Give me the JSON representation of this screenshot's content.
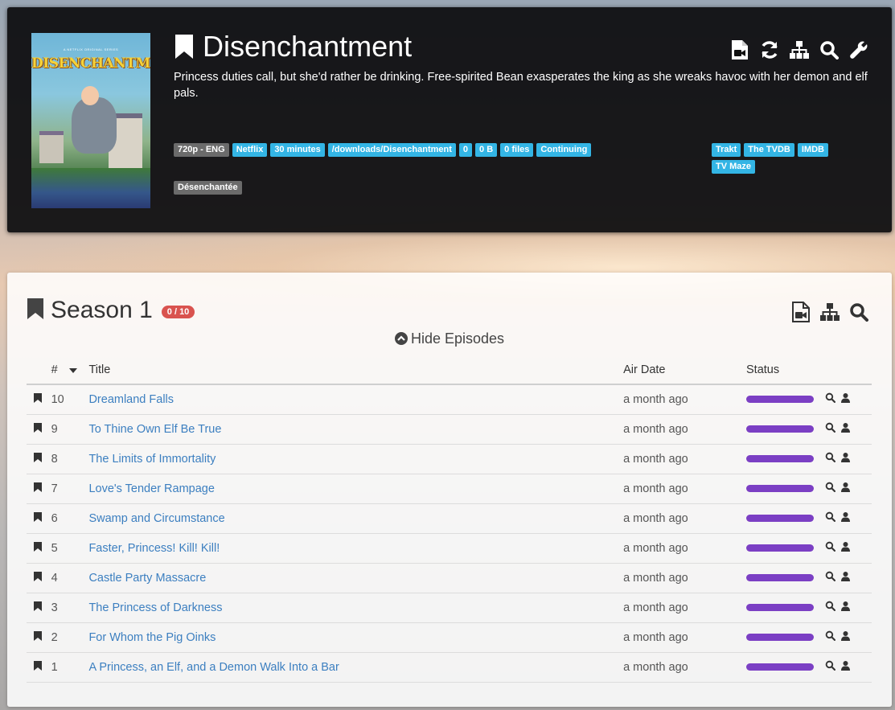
{
  "show": {
    "title": "Disenchantment",
    "description": "Princess duties call, but she'd rather be drinking. Free-spirited Bean exasperates the king as she wreaks havoc with her demon and elf pals.",
    "poster": {
      "tagline": "A NETFLIX ORIGINAL SERIES",
      "logo_text": "DISENCHANTMENT"
    },
    "actions": [
      "file-video-icon",
      "refresh-icon",
      "sitemap-icon",
      "search-icon",
      "wrench-icon"
    ],
    "tags": [
      "720p - ENG",
      "Netflix",
      "30 minutes",
      "/downloads/Disenchantment",
      "0",
      "0 B",
      "0 files",
      "Continuing"
    ],
    "alt_name": "Désenchantée",
    "links": [
      "Trakt",
      "The TVDB",
      "IMDB",
      "TV Maze"
    ]
  },
  "season": {
    "title": "Season 1",
    "count": "0 / 10",
    "actions": [
      "file-video-icon",
      "sitemap-icon",
      "search-icon"
    ],
    "toggle_label": "Hide Episodes",
    "columns": {
      "number": "#",
      "title": "Title",
      "air_date": "Air Date",
      "status": "Status"
    },
    "episodes": [
      {
        "number": "10",
        "title": "Dreamland Falls",
        "air_date": "a month ago",
        "progress": 0
      },
      {
        "number": "9",
        "title": "To Thine Own Elf Be True",
        "air_date": "a month ago",
        "progress": 0
      },
      {
        "number": "8",
        "title": "The Limits of Immortality",
        "air_date": "a month ago",
        "progress": 0
      },
      {
        "number": "7",
        "title": "Love's Tender Rampage",
        "air_date": "a month ago",
        "progress": 0
      },
      {
        "number": "6",
        "title": "Swamp and Circumstance",
        "air_date": "a month ago",
        "progress": 0
      },
      {
        "number": "5",
        "title": "Faster, Princess! Kill! Kill!",
        "air_date": "a month ago",
        "progress": 0
      },
      {
        "number": "4",
        "title": "Castle Party Massacre",
        "air_date": "a month ago",
        "progress": 0
      },
      {
        "number": "3",
        "title": "The Princess of Darkness",
        "air_date": "a month ago",
        "progress": 0
      },
      {
        "number": "2",
        "title": "For Whom the Pig Oinks",
        "air_date": "a month ago",
        "progress": 0
      },
      {
        "number": "1",
        "title": "A Princess, an Elf, and a Demon Walk Into a Bar",
        "air_date": "a month ago",
        "progress": 0
      }
    ]
  },
  "colors": {
    "accent": "#33b5e5",
    "status_bar": "#7b3fc4",
    "badge_danger": "#d9534f",
    "link": "#3c7fc0"
  }
}
